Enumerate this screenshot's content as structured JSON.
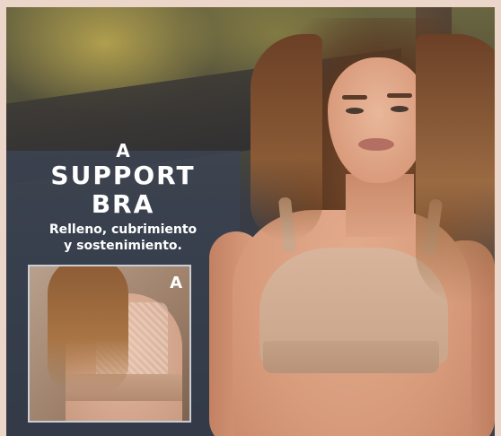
{
  "product": {
    "letter": "A",
    "title_line1": "SUPPORT",
    "title_line2": "BRA",
    "description_line1": "Relleno, cubrimiento",
    "description_line2": "y sostenimiento."
  },
  "inset": {
    "label": "A"
  },
  "colors": {
    "frame": "#ecd6c9",
    "text": "#ffffff",
    "bra": "#d7b49b"
  }
}
